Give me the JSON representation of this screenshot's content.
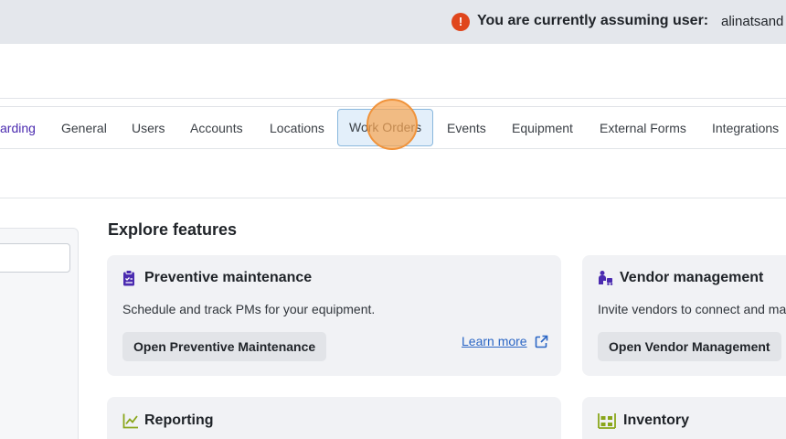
{
  "banner": {
    "icon": "alert-icon",
    "message": "You are currently assuming user:",
    "user": "alinatsand"
  },
  "tabs": [
    {
      "label": "arding"
    },
    {
      "label": "General"
    },
    {
      "label": "Users"
    },
    {
      "label": "Accounts"
    },
    {
      "label": "Locations"
    },
    {
      "label": "Work Orders",
      "active": true
    },
    {
      "label": "Events"
    },
    {
      "label": "Equipment"
    },
    {
      "label": "External Forms"
    },
    {
      "label": "Integrations"
    }
  ],
  "explore": {
    "title": "Explore features",
    "cards": [
      {
        "title": "Preventive maintenance",
        "icon": "clipboard-icon",
        "description": "Schedule and track PMs for your equipment.",
        "button": "Open Preventive Maintenance",
        "learn_more": "Learn more"
      },
      {
        "title": "Vendor management",
        "icon": "vendor-icon",
        "description": "Invite vendors to connect and ma",
        "button": "Open Vendor Management"
      },
      {
        "title": "Reporting",
        "icon": "chart-line-icon"
      },
      {
        "title": "Inventory",
        "icon": "inventory-icon"
      }
    ]
  },
  "colors": {
    "accent_purple": "#4b2bb0",
    "alert_red": "#e0461c",
    "link_blue": "#2b66c5",
    "reporting_green": "#8aa61b"
  }
}
